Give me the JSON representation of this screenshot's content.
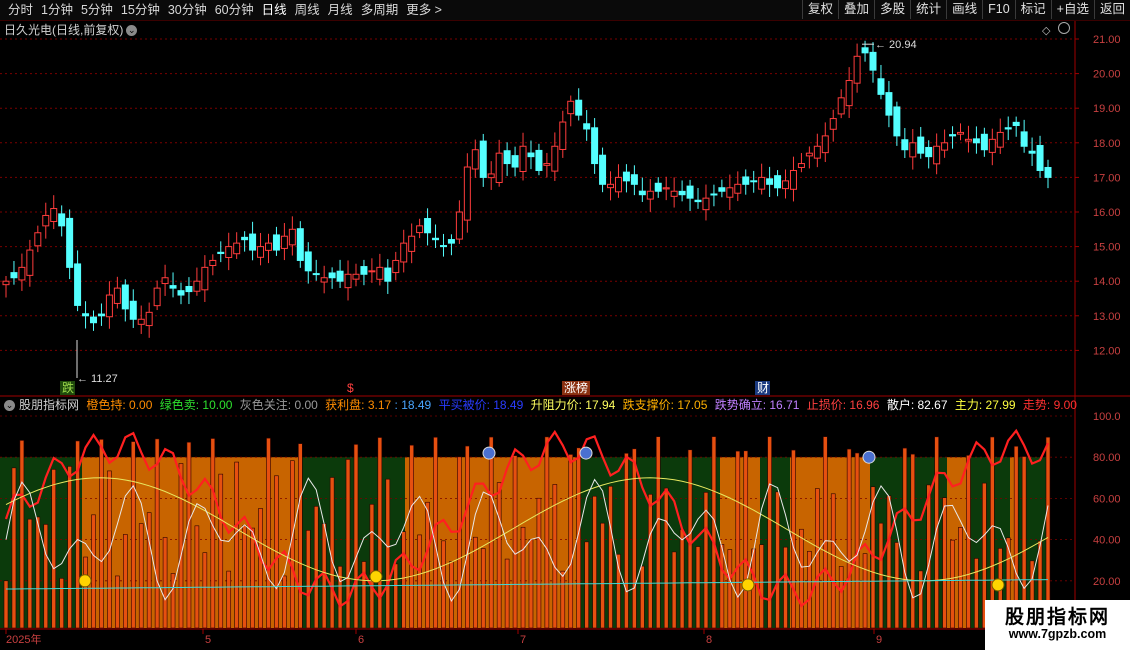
{
  "toolbar": {
    "periods": [
      {
        "label": "分时"
      },
      {
        "label": "1分钟"
      },
      {
        "label": "5分钟"
      },
      {
        "label": "15分钟"
      },
      {
        "label": "30分钟"
      },
      {
        "label": "60分钟"
      },
      {
        "label": "日线"
      },
      {
        "label": "周线"
      },
      {
        "label": "月线"
      },
      {
        "label": "多周期"
      },
      {
        "label": "更多 >"
      }
    ],
    "active_period": "日线",
    "buttons": [
      {
        "label": "复权"
      },
      {
        "label": "叠加"
      },
      {
        "label": "多股"
      },
      {
        "label": "统计"
      },
      {
        "label": "画线"
      },
      {
        "label": "F10"
      },
      {
        "label": "标记"
      },
      {
        "label": "+自选"
      },
      {
        "label": "返回"
      }
    ]
  },
  "main_chart": {
    "title": "日久光电(日线,前复权)",
    "title_icon": "chevron-down-icon",
    "high_label": "20.94",
    "low_label": "11.27",
    "y_ticks": [
      "21.00",
      "20.00",
      "19.00",
      "18.00",
      "17.00",
      "16.00",
      "15.00",
      "14.00",
      "13.00",
      "12.00"
    ],
    "event_tags": [
      {
        "text": "跌",
        "color": "#9bd84a",
        "bg": "#1f4a0c"
      },
      {
        "text": "$",
        "color": "#ff4040",
        "bg": "#000000"
      },
      {
        "text": "涨榜",
        "color": "#ffffff",
        "bg": "#8a3010"
      },
      {
        "text": "财",
        "color": "#ffffff",
        "bg": "#1b3a80"
      }
    ],
    "up_color": "#ff3c3c",
    "down_color": "#54ffff"
  },
  "indicator": {
    "name": "股朋指标网",
    "items": [
      {
        "text": "橙色持: 0.00",
        "color": "#ff8c00"
      },
      {
        "text": "绿色卖: 10.00",
        "color": "#2ee02e"
      },
      {
        "text": "灰色关注: 0.00",
        "color": "#9a9a9a"
      },
      {
        "text": "获利盘: 3.17",
        "color": "#ff8c00"
      },
      {
        "text": ": 18.49",
        "color": "#4aa6ff"
      },
      {
        "text": "平买被价: 18.49",
        "color": "#2a3cff"
      },
      {
        "text": "升阻力价: 17.94",
        "color": "#ffff60"
      },
      {
        "text": "跌支撑价: 17.05",
        "color": "#ffb000"
      },
      {
        "text": "跌势确立: 16.71",
        "color": "#c080ff"
      },
      {
        "text": "止损价: 16.96",
        "color": "#ff4040"
      },
      {
        "text": "散户: 82.67",
        "color": "#ffffff"
      },
      {
        "text": "主力: 27.99",
        "color": "#ffff40"
      },
      {
        "text": "走势: 9.00",
        "color": "#ff3030"
      }
    ],
    "y_ticks": [
      "100.0",
      "80.00",
      "60.00",
      "40.00",
      "20.00"
    ]
  },
  "x_axis": {
    "labels": [
      "2025年",
      "5",
      "6",
      "7",
      "8",
      "9"
    ]
  },
  "watermark": {
    "title": "股朋指标网",
    "url": "www.7gpzb.com"
  },
  "colors": {
    "grid": "#7a0000",
    "axis": "#a00000",
    "green_zone": "#0b3a0b",
    "orange_zone": "#c86400"
  }
}
